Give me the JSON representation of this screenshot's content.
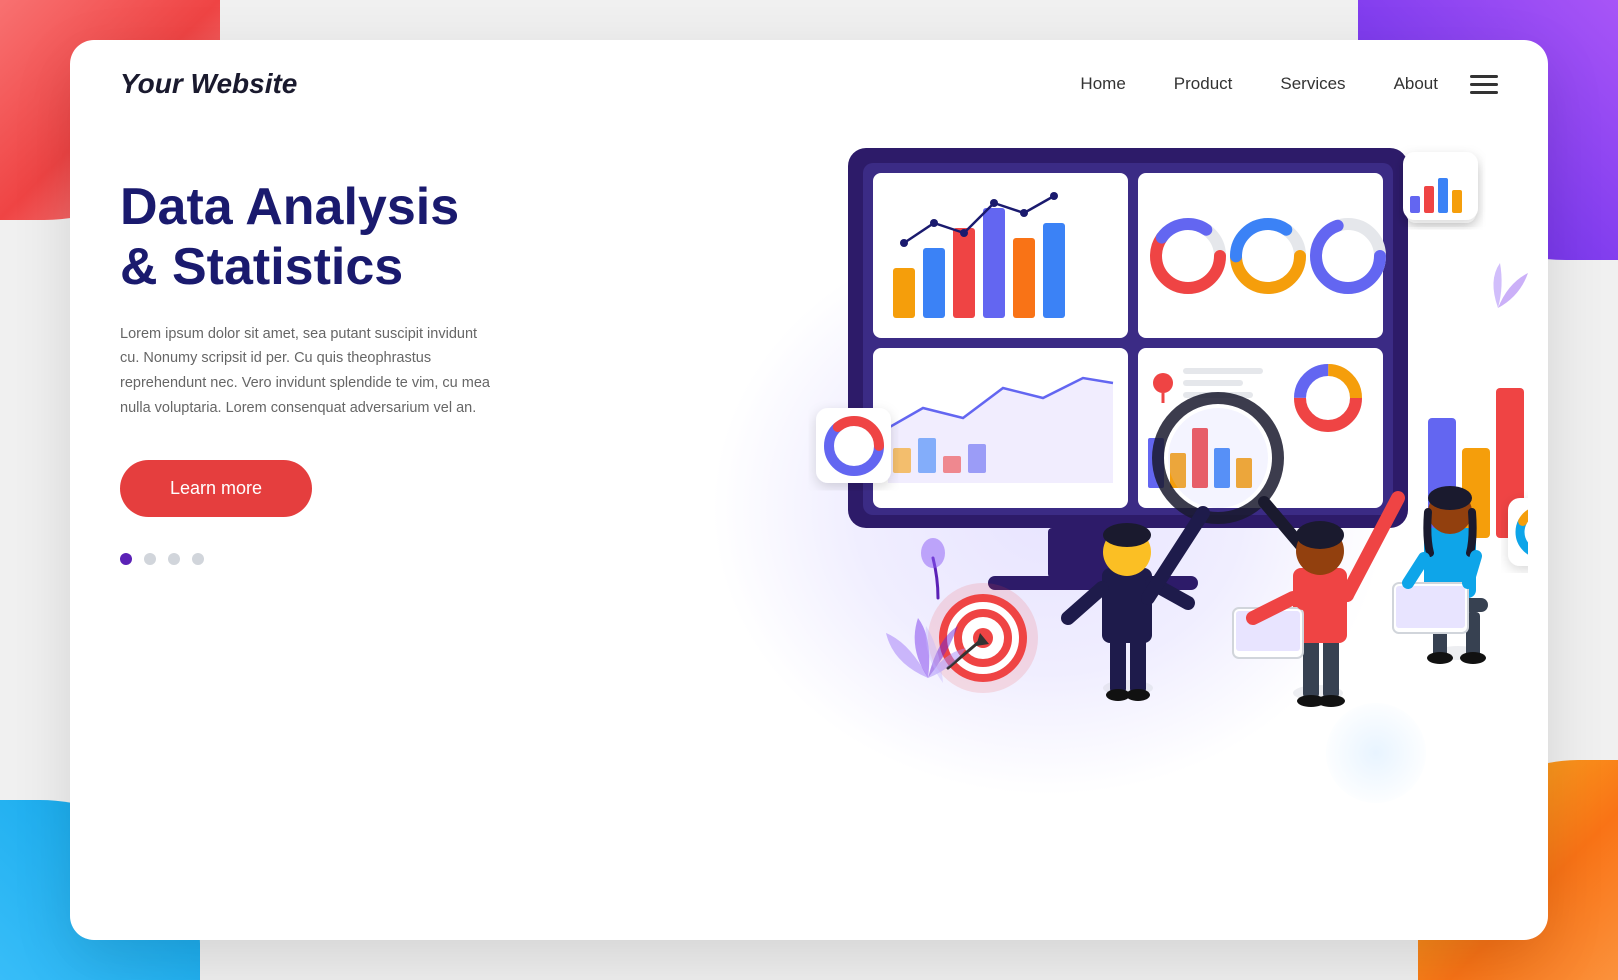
{
  "background": {
    "colors": {
      "tl": "#ef4444",
      "tr": "#7c3aed",
      "bl": "#38bdf8",
      "br": "#f97316"
    }
  },
  "navbar": {
    "logo": "Your Website",
    "links": [
      {
        "label": "Home",
        "id": "home"
      },
      {
        "label": "Product",
        "id": "product"
      },
      {
        "label": "Services",
        "id": "services"
      },
      {
        "label": "About",
        "id": "about"
      }
    ],
    "menu_icon": "hamburger-menu"
  },
  "hero": {
    "title_line1": "Data Analysis",
    "title_line2": "& Statistics",
    "description": "Lorem ipsum dolor sit amet, sea putant suscipit invidunt cu. Nonumy scripsit id per. Cu quis theophrastus reprehendunt nec. Vero invidunt splendide te vim, cu mea nulla voluptaria. Lorem consenquat adversarium vel an.",
    "cta_button": "Learn more",
    "dots": [
      {
        "active": true
      },
      {
        "active": false
      },
      {
        "active": false
      },
      {
        "active": false
      }
    ]
  },
  "illustration": {
    "monitor_color": "#2d1b69",
    "charts": {
      "bar_colors": [
        "#f59e0b",
        "#3b82f6",
        "#ef4444",
        "#6366f1",
        "#f97316"
      ],
      "donut_colors": [
        "#ef4444",
        "#6366f1",
        "#f59e0b"
      ],
      "line_color": "#6366f1"
    },
    "outside_bar_colors": [
      "#6366f1",
      "#f59e0b",
      "#ef4444"
    ],
    "outside_bar_heights": [
      120,
      80,
      150
    ]
  }
}
